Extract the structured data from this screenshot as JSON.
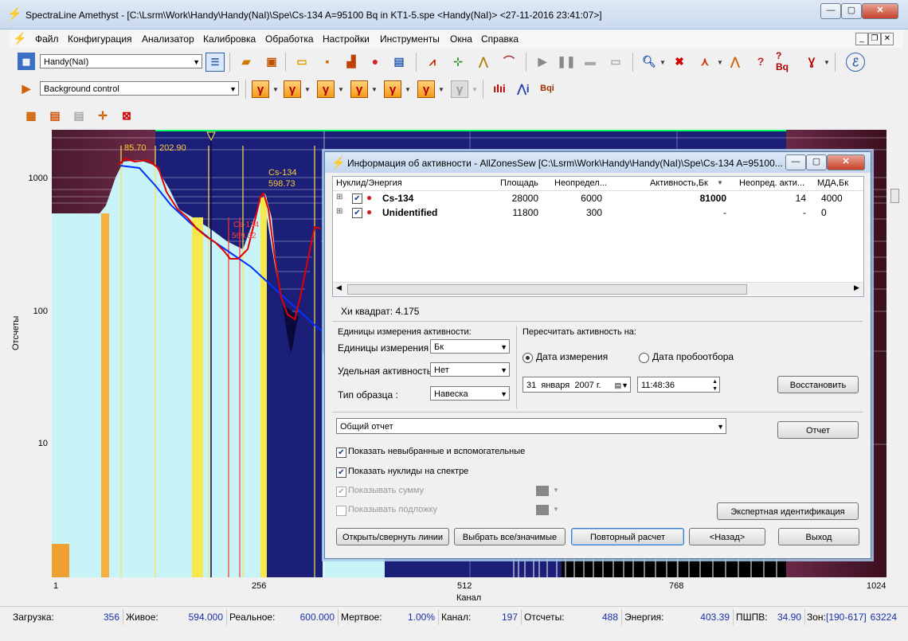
{
  "window": {
    "title": "SpectraLine Amethyst - [C:\\Lsrm\\Work\\Handy\\Handy(NaI)\\Spe\\Cs-134 A=95100 Bq  in KT1-5.spe <Handy(NaI)> <27-11-2016 23:41:07>]"
  },
  "menu": {
    "items": [
      "Файл",
      "Конфигурация",
      "Анализатор",
      "Калибровка",
      "Обработка",
      "Настройки",
      "Инструменты",
      "Окна",
      "Справка"
    ]
  },
  "toolbar": {
    "device_combo": "Handy(NaI)",
    "control_combo": "Background control"
  },
  "chart": {
    "ylabel": "Отсчеты",
    "xlabel": "Канал",
    "y_ticks": [
      "1000",
      "100",
      "10"
    ],
    "x_ticks": [
      "1",
      "256",
      "512",
      "768",
      "1024"
    ],
    "peak_labels": {
      "p1": "85.70",
      "p2": "202.90",
      "cs_a": "Cs-134",
      "cs_a_e": "598.73",
      "cs_b": "Cs-134",
      "cs_b_e": "569.32"
    }
  },
  "dialog": {
    "title": "Информация об активности - AllZonesSew  [C:\\Lsrm\\Work\\Handy\\Handy(NaI)\\Spe\\Cs-134 A=95100...",
    "columns": [
      "Нуклид/Энергия",
      "Площадь",
      "Неопредел...",
      "Активность,Бк",
      "Неопред. акти...",
      "МДА,Бк"
    ],
    "rows": [
      {
        "nuclide": "Cs-134",
        "area": "28000",
        "unc": "6000",
        "activity": "81000",
        "act_unc": "14",
        "mda": "4000"
      },
      {
        "nuclide": "Unidentified",
        "area": "11800",
        "unc": "300",
        "activity": "-",
        "act_unc": "-",
        "mda": "0"
      }
    ],
    "chi": "Хи квадрат: 4.175",
    "units_group": "Единицы измерения активности:",
    "units_label": "Единицы измерения :",
    "units_value": "Бк",
    "specific_label": "Удельная активность :",
    "specific_value": "Нет",
    "sample_label": "Тип образца :",
    "sample_value": "Навеска",
    "recalc_group": "Пересчитать активность на:",
    "radio_measure": "Дата измерения",
    "radio_sampling": "Дата пробоотбора",
    "date_day": "31",
    "date_month": "января",
    "date_year": "2007 г.",
    "time": "11:48:36",
    "restore_btn": "Восстановить",
    "report_combo": "Общий отчет",
    "report_btn": "Отчет",
    "cb_show_unselected": "Показать невыбранные и вспомогательные",
    "cb_show_nuclides": "Показать нуклиды на спектре",
    "cb_show_sum": "Показывать сумму",
    "cb_show_bg": "Показывать подложку",
    "expert_btn": "Экспертная идентификация",
    "btn_toggle_lines": "Открыть/свернуть линии",
    "btn_select_all": "Выбрать все/значимые",
    "btn_recalc": "Повторный расчет",
    "btn_back": "<Назад>",
    "btn_exit": "Выход"
  },
  "status": {
    "load_label": "Загрузка:",
    "load": "356",
    "live_label": "Живое:",
    "live": "594.000",
    "real_label": "Реальное:",
    "real": "600.000",
    "dead_label": "Мертвое:",
    "dead": "1.00%",
    "channel_label": "Канал:",
    "channel": "197",
    "counts_label": "Отсчеты:",
    "counts": "488",
    "energy_label": "Энергия:",
    "energy": "403.39",
    "fwhm_label": "ПШПВ:",
    "fwhm": "34.90",
    "zones_label": "Зон:",
    "zones": "[190-617]",
    "zones_count": "63224"
  },
  "colors": {
    "plot_bg": "#1b1f78",
    "fill": "#c8f4f8",
    "fit": "#e00000",
    "baseline": "#0030ff",
    "peak_label": "#ffcc33"
  }
}
